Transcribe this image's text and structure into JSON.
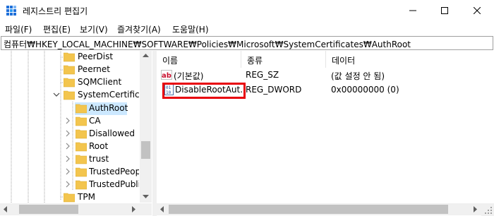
{
  "window": {
    "title": "레지스트리 편집기"
  },
  "menu": [
    {
      "label": "파일(F)"
    },
    {
      "label": "편집(E)"
    },
    {
      "label": "보기(V)"
    },
    {
      "label": "즐겨찾기(A)"
    },
    {
      "label": "도움말(H)"
    }
  ],
  "address": "컴퓨터₩HKEY_LOCAL_MACHINE₩SOFTWARE₩Policies₩Microsoft₩SystemCertificates₩AuthRoot",
  "tree": [
    {
      "label": "PeerDist",
      "expandable": false
    },
    {
      "label": "Peernet",
      "expandable": false
    },
    {
      "label": "SQMClient",
      "expandable": false
    },
    {
      "label": "SystemCertificates",
      "expandable": true,
      "expanded": true
    },
    {
      "label": "AuthRoot",
      "expandable": false,
      "selected": true
    },
    {
      "label": "CA",
      "expandable": true
    },
    {
      "label": "Disallowed",
      "expandable": true
    },
    {
      "label": "Root",
      "expandable": true
    },
    {
      "label": "trust",
      "expandable": true
    },
    {
      "label": "TrustedPeople",
      "expandable": true
    },
    {
      "label": "TrustedPublisher",
      "expandable": true
    },
    {
      "label": "TPM",
      "expandable": false
    }
  ],
  "columns": {
    "name": "이름",
    "type": "종류",
    "data": "데이터"
  },
  "values": [
    {
      "icon": "ab",
      "name": "(기본값)",
      "type": "REG_SZ",
      "data": "(값 설정 안 됨)"
    },
    {
      "icon": "dword",
      "name": "DisableRootAut...",
      "type": "REG_DWORD",
      "data": "0x00000000 (0)"
    }
  ],
  "colors": {
    "highlight_box": "#e8000b",
    "selected_bg": "#cce8ff",
    "folder": "#f3c54e"
  }
}
